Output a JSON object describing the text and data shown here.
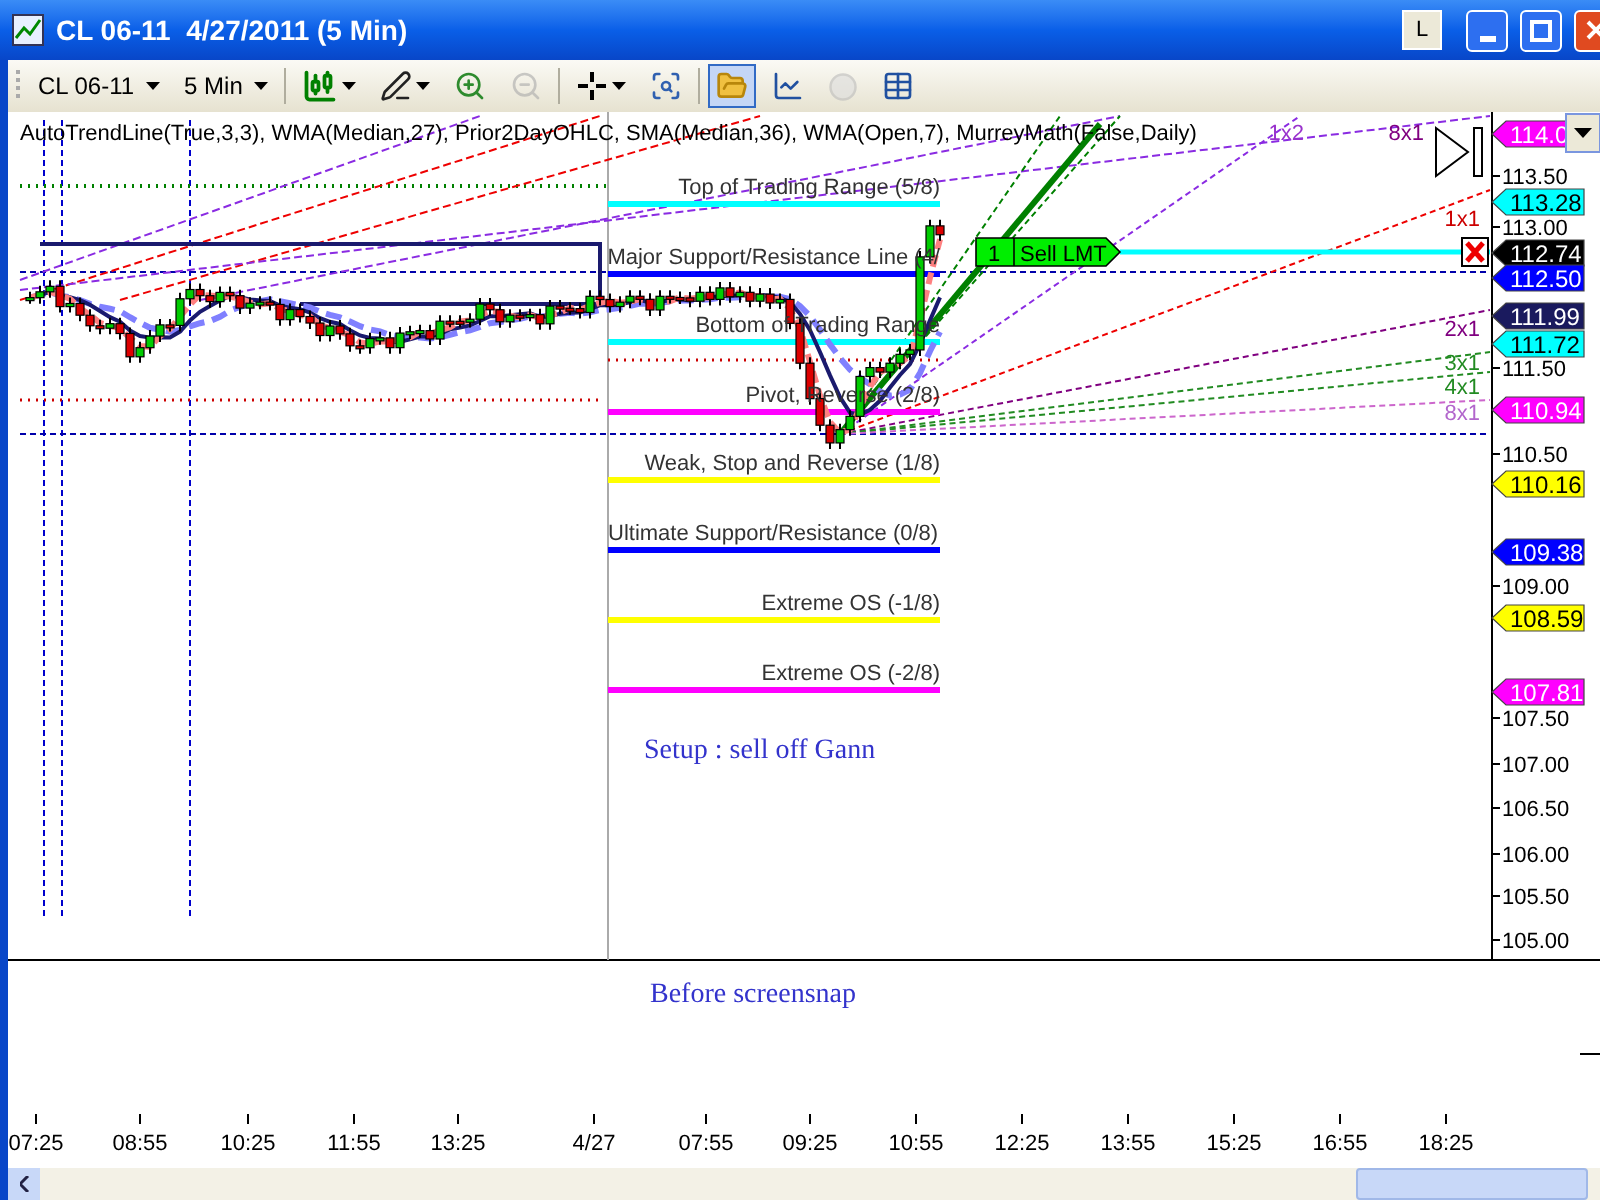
{
  "window": {
    "title": "CL 06-11  4/27/2011 (5 Min)",
    "title_button": "L"
  },
  "toolbar": {
    "instrument": "CL 06-11",
    "interval": "5 Min",
    "tools": [
      {
        "pressed": false,
        "disabled": false
      },
      {
        "pressed": false,
        "disabled": false
      },
      {
        "pressed": false,
        "disabled": false
      },
      {
        "pressed": false,
        "disabled": true
      },
      {
        "pressed": false,
        "disabled": false
      },
      {
        "pressed": false,
        "disabled": false
      },
      {
        "pressed": true,
        "disabled": false
      },
      {
        "pressed": false,
        "disabled": false
      },
      {
        "pressed": false,
        "disabled": true
      },
      {
        "pressed": false,
        "disabled": false
      }
    ]
  },
  "chart": {
    "indicators": "AutoTrendLine(True,3,3), WMA(Median,27), Prior2DayOHLC, SMA(Median,36), WMA(Open,7), MurreyMath(False,Daily)",
    "levels": [
      {
        "label": "Top of Trading Range (5/8)",
        "color": "#00ffff"
      },
      {
        "label": "Major Support/Resistance Line (4/",
        "color": "#0000ff"
      },
      {
        "label": "Bottom of Trading Range",
        "color": "#00ffff"
      },
      {
        "label": "Pivot, Reverse (2/8)",
        "color": "#ff00ff"
      },
      {
        "label": "Weak, Stop and Reverse (1/8)",
        "color": "#ffff00"
      },
      {
        "label": "Ultimate Support/Resistance (0/8)",
        "color": "#0000ff"
      },
      {
        "label": "Extreme OS (-1/8)",
        "color": "#ffff00"
      },
      {
        "label": "Extreme OS (-2/8)",
        "color": "#ff00ff"
      }
    ],
    "fan_labels": [
      {
        "label": "1x2",
        "color": "#9932cc"
      },
      {
        "label": "8x1",
        "color": "#800080"
      },
      {
        "label": "1x1",
        "color": "#cc0000"
      },
      {
        "label": "2x1",
        "color": "#800080"
      },
      {
        "label": "3x1",
        "color": "#228b22"
      },
      {
        "label": "4x1",
        "color": "#228b22"
      },
      {
        "label": "8x1",
        "color": "#b266cc"
      }
    ],
    "order": {
      "quantity": "1",
      "type": "Sell LMT"
    },
    "price_ticks": [
      "113.50",
      "113.00",
      "111.50",
      "110.50",
      "109.00",
      "107.50",
      "107.00",
      "106.50",
      "106.00",
      "105.50",
      "105.00"
    ],
    "price_tags": [
      {
        "value": "114.0",
        "color": "#ff00ff"
      },
      {
        "value": "113.28",
        "color": "#00ffff"
      },
      {
        "value": "112.74",
        "color": "#000000"
      },
      {
        "value": "112.50",
        "color": "#0000ff"
      },
      {
        "value": "111.99",
        "color": "#1a1a5e"
      },
      {
        "value": "111.72",
        "color": "#00ffff"
      },
      {
        "value": "110.94",
        "color": "#ff00ff"
      },
      {
        "value": "110.16",
        "color": "#ffff00"
      },
      {
        "value": "109.38",
        "color": "#0000ff"
      },
      {
        "value": "108.59",
        "color": "#ffff00"
      },
      {
        "value": "107.81",
        "color": "#ff00ff"
      }
    ],
    "note": "Setup : sell off Gann"
  },
  "lower_panel": {
    "note": "Before screensnap"
  },
  "time_axis": [
    "07:25",
    "08:55",
    "10:25",
    "11:55",
    "13:25",
    "4/27",
    "07:55",
    "09:25",
    "10:55",
    "12:25",
    "13:55",
    "15:25",
    "16:55",
    "18:25"
  ]
}
